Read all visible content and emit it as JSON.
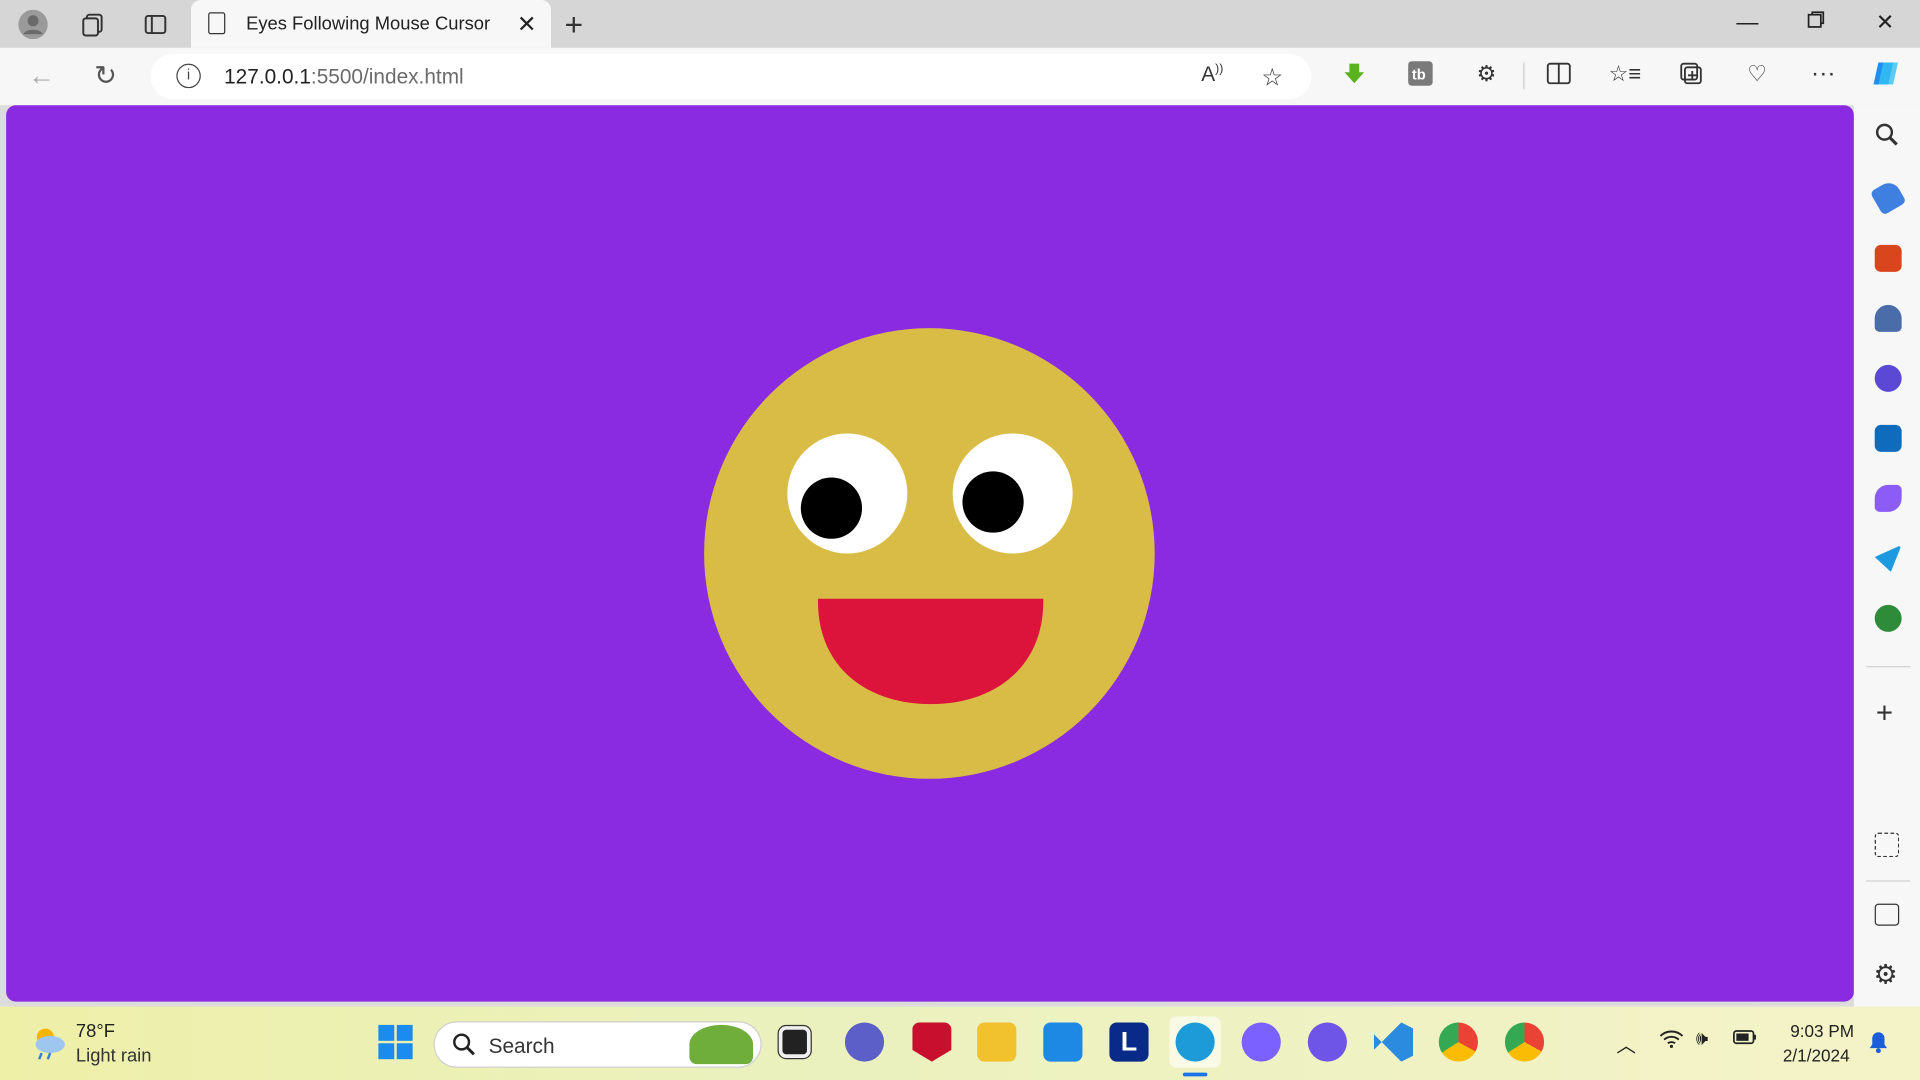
{
  "browser": {
    "tab_title": "Eyes Following Mouse Cursor",
    "url_host": "127.0.0.1",
    "url_path": ":5500/index.html"
  },
  "page": {
    "background": "#8a2be2",
    "face_color": "#d9bc46",
    "mouth_color": "#dc143c"
  },
  "taskbar": {
    "weather_temp": "78°F",
    "weather_desc": "Light rain",
    "search_label": "Search",
    "time": "9:03 PM",
    "date": "2/1/2024"
  }
}
